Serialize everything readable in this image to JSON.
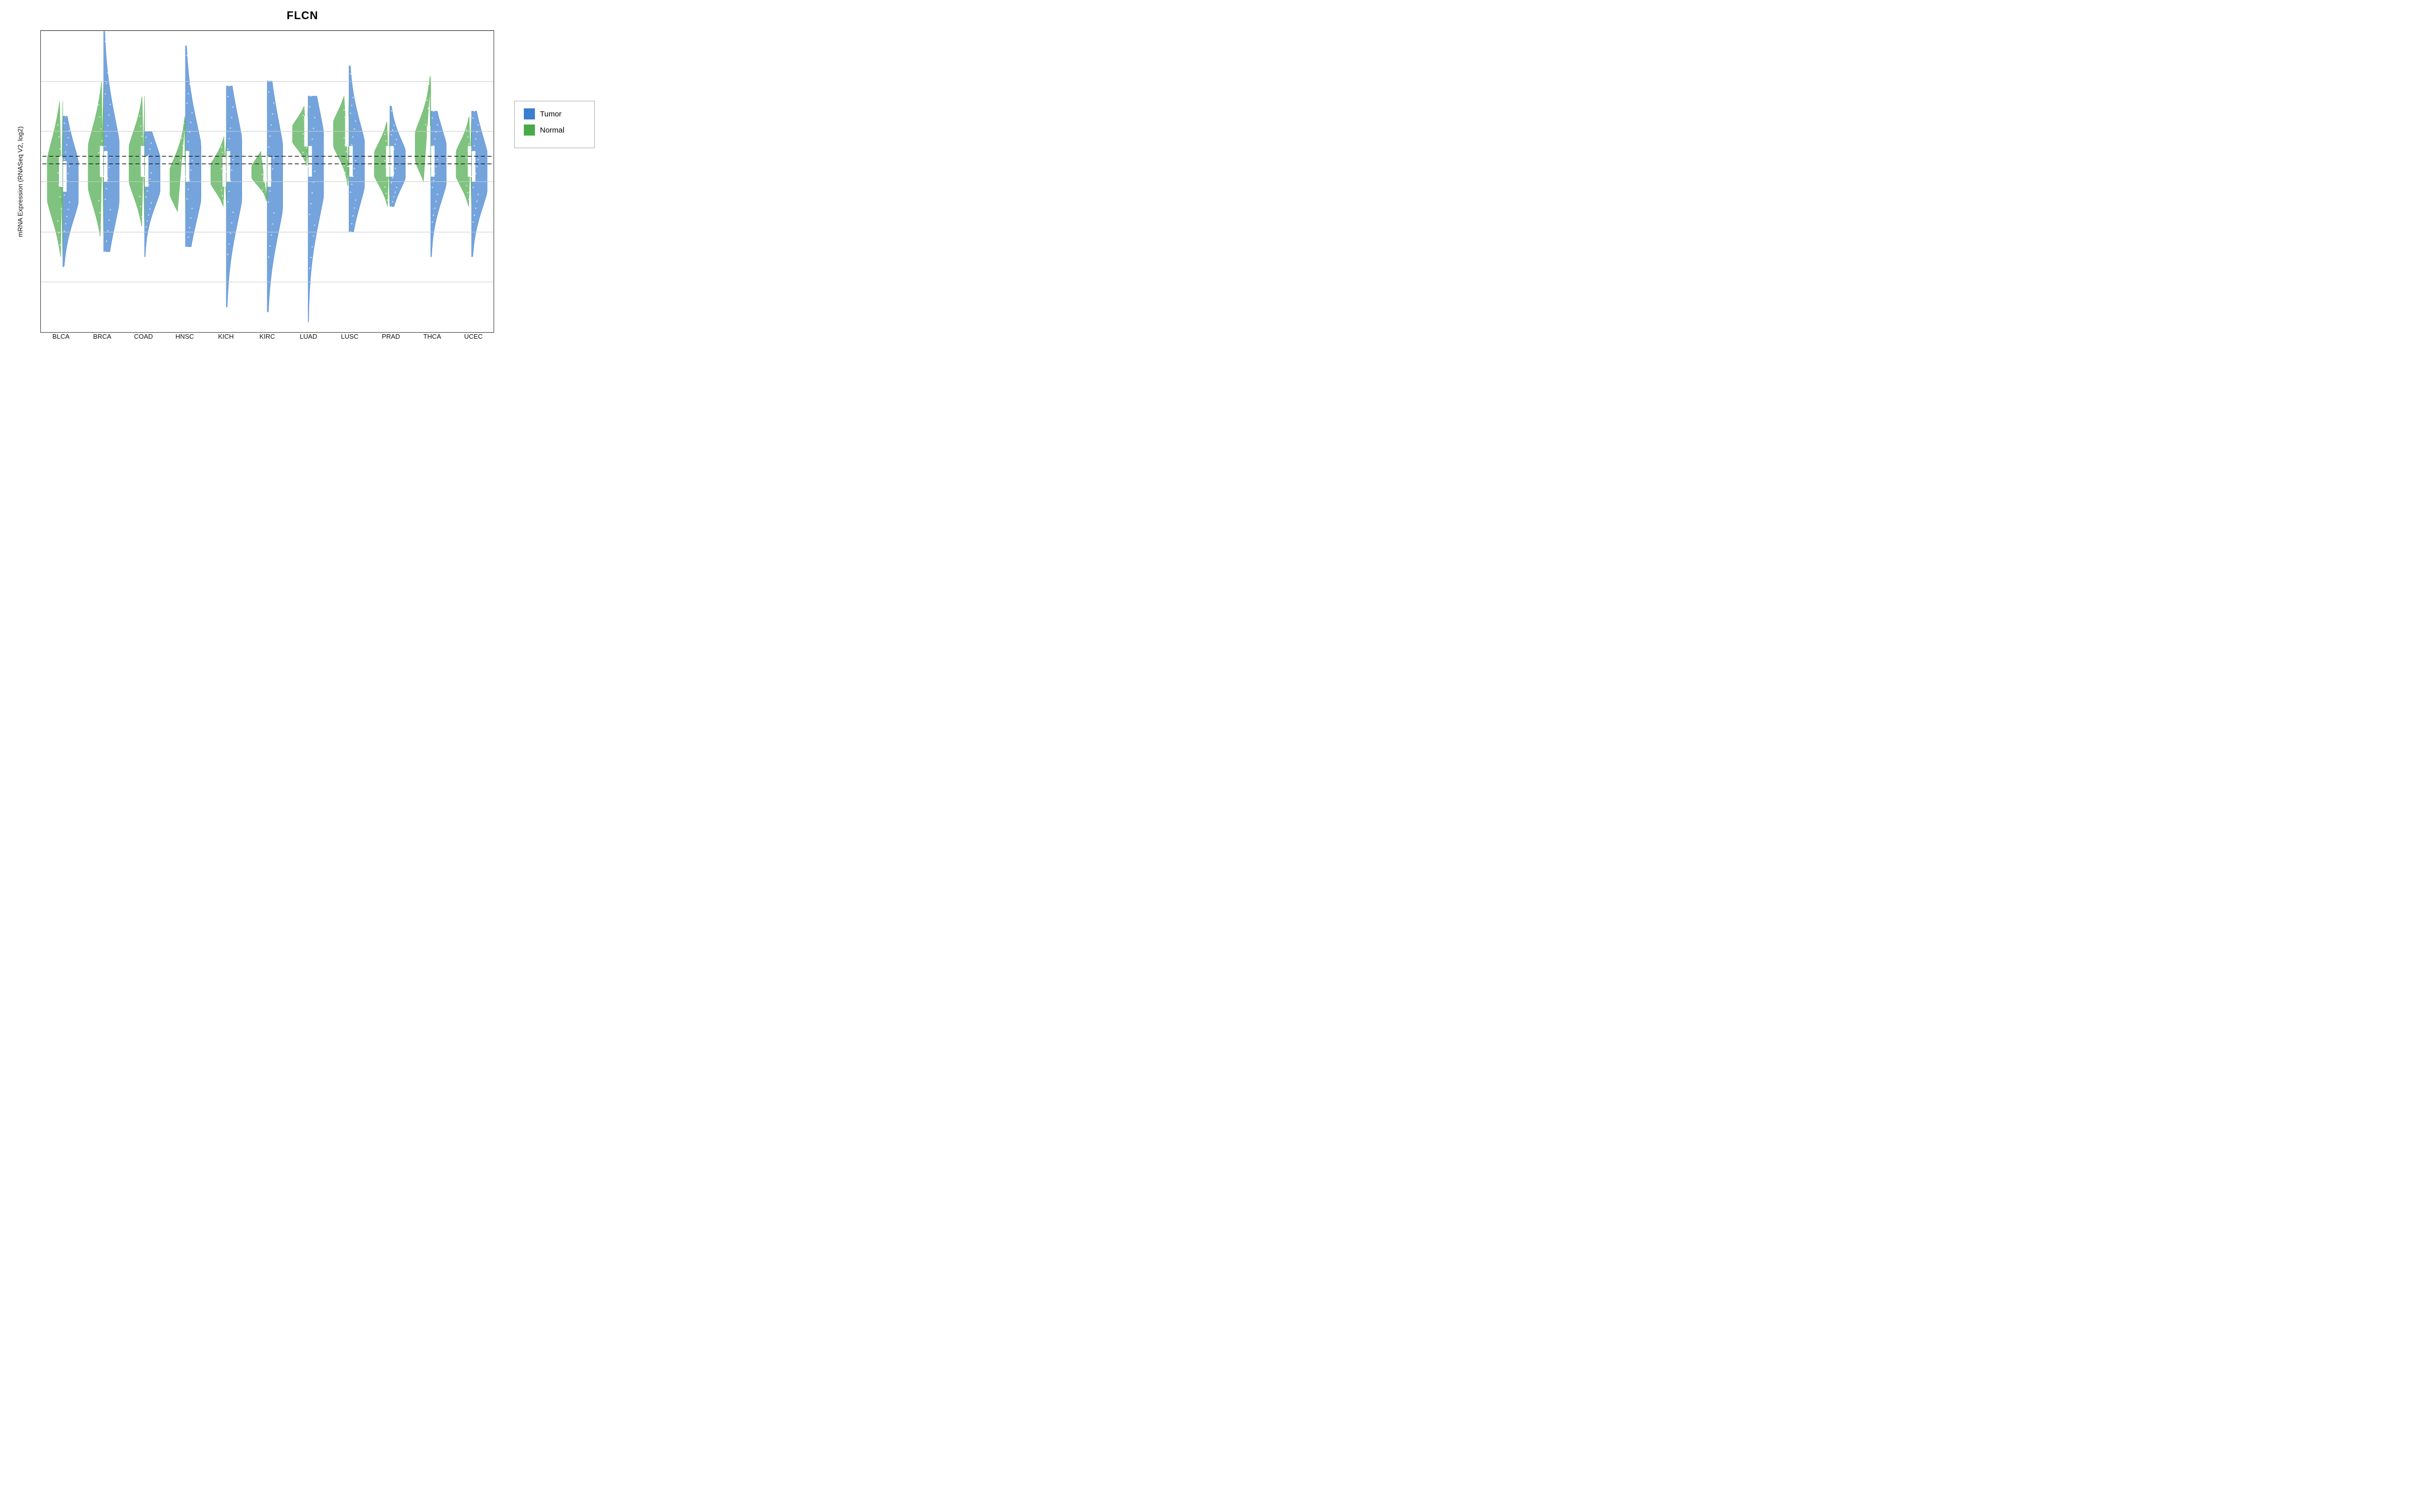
{
  "title": "FLCN",
  "yAxisLabel": "mRNA Expression (RNASeq V2, log2)",
  "yMin": 6,
  "yMax": 12,
  "yTicks": [
    6,
    7,
    8,
    9,
    10,
    11,
    12
  ],
  "refLine1": 9.35,
  "refLine2": 9.5,
  "xLabels": [
    "BLCA",
    "BRCA",
    "COAD",
    "HNSC",
    "KICH",
    "KIRC",
    "LUAD",
    "LUSC",
    "PRAD",
    "THCA",
    "UCEC"
  ],
  "legend": {
    "items": [
      {
        "label": "Tumor",
        "color": "#3a7ecf"
      },
      {
        "label": "Normal",
        "color": "#4aaa4a"
      }
    ]
  },
  "colors": {
    "tumor": "#3a7ecf",
    "normal": "#4aaa4a",
    "tumorLight": "#6aaae8",
    "normalLight": "#7acc7a"
  }
}
